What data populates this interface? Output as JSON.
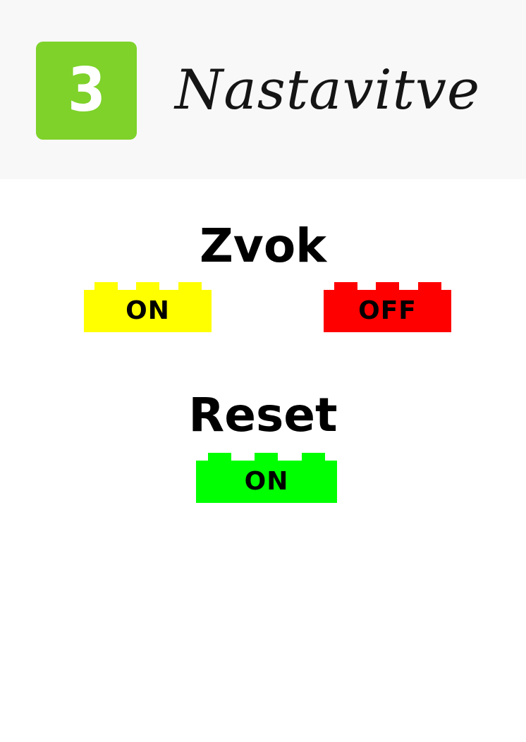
{
  "header": {
    "step_number": "3",
    "title": "Nastavitve"
  },
  "sections": {
    "sound": {
      "title": "Zvok",
      "on_label": "ON",
      "off_label": "OFF"
    },
    "reset": {
      "title": "Reset",
      "on_label": "ON"
    }
  },
  "colors": {
    "badge": "#7ed22a",
    "on_button": "#ffff00",
    "off_button": "#ff0000",
    "reset_button": "#00ff00"
  }
}
